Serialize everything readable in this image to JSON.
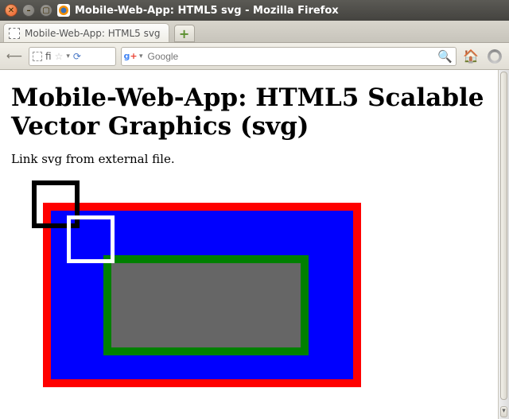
{
  "window": {
    "title": "Mobile-Web-App: HTML5 svg - Mozilla Firefox"
  },
  "tabs": {
    "active_label": "Mobile-Web-App: HTML5 svg"
  },
  "toolbar": {
    "url_text": "fi",
    "search_placeholder": "Google"
  },
  "page": {
    "heading": "Mobile-Web-App: HTML5 Scalable Vector Graphics (svg)",
    "paragraph": "Link svg from external file."
  },
  "svg_shapes": {
    "outer_border": "red",
    "fill_main": "blue",
    "inner_border": "green",
    "inner_fill": "gray",
    "accent_square_1": "black-outline",
    "accent_square_2": "white-outline"
  }
}
